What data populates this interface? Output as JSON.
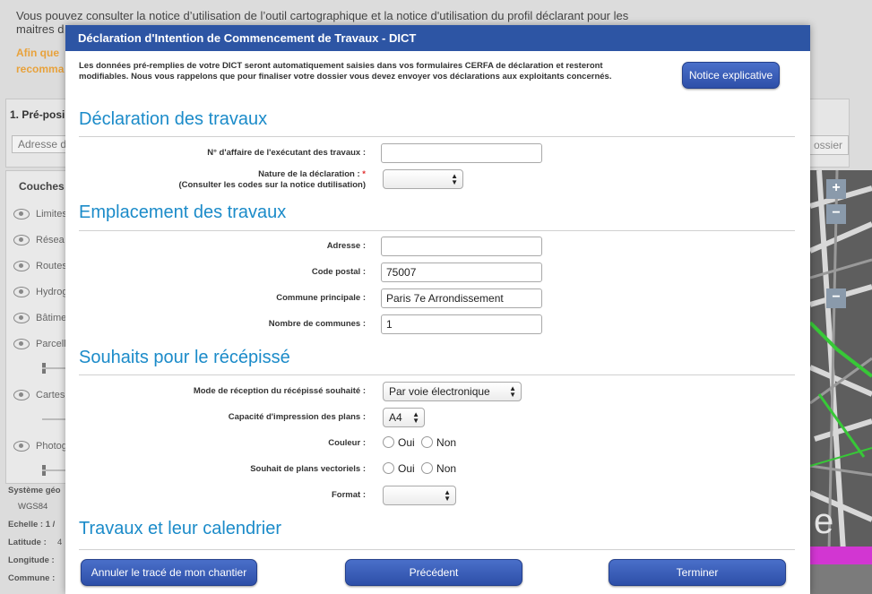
{
  "background": {
    "intro_text": "Vous pouvez consulter la notice d’utilisation de l’outil cartographique et la notice d'utilisation du profil déclarant pour les maitres d",
    "warning_line1": "Afin que",
    "warning_line2": "recomma",
    "panel_title": "1. Pré-posi",
    "address_placeholder": "Adresse d",
    "right_button": "ossier",
    "layers_title": "Couches",
    "layers": [
      "Limites",
      "Résea",
      "Routes",
      "Hydrog",
      "Bâtime",
      "Parcell",
      "Cartes",
      "Photog"
    ],
    "coords": {
      "system_label": "Système géo",
      "system_value": "WGS84",
      "scale_label": "Echelle : 1 /",
      "latitude_label": "Latitude :",
      "latitude_value": "4",
      "longitude_label": "Longitude :",
      "commune_label": "Commune :"
    },
    "zoom_in": "+",
    "zoom_out": "−",
    "zoom_minus": "−"
  },
  "modal": {
    "title": "Déclaration d'Intention de Commencement de Travaux - DICT",
    "notice_text": "Les données pré-remplies de votre DICT seront automatiquement saisies dans vos formulaires CERFA de déclaration et resteront modifiables. Nous vous rappelons que pour finaliser votre dossier vous devez envoyer vos déclarations aux exploitants concernés.",
    "notice_button": "Notice explicative",
    "sections": {
      "travaux": {
        "title": "Déclaration des travaux",
        "affaire_label": "N° d'affaire de l'exécutant des travaux :",
        "affaire_value": "",
        "nature_label": "Nature de la déclaration :",
        "nature_required": "*",
        "nature_hint": "(Consulter les codes sur la notice dutilisation)",
        "nature_value": ""
      },
      "emplacement": {
        "title": "Emplacement des travaux",
        "adresse_label": "Adresse :",
        "adresse_value": "",
        "code_postal_label": "Code postal :",
        "code_postal_value": "75007",
        "commune_label": "Commune principale :",
        "commune_value": "Paris 7e Arrondissement",
        "nb_communes_label": "Nombre de communes :",
        "nb_communes_value": "1"
      },
      "recepisse": {
        "title": "Souhaits pour le récépissé",
        "mode_label": "Mode de réception du récépissé souhaité :",
        "mode_value": "Par voie électronique",
        "capacite_label": "Capacité d'impression des plans :",
        "capacite_value": "A4",
        "couleur_label": "Couleur :",
        "vectoriels_label": "Souhait de plans vectoriels :",
        "oui": "Oui",
        "non": "Non",
        "format_label": "Format :",
        "format_value": ""
      },
      "calendrier": {
        "title": "Travaux et leur calendrier"
      }
    },
    "footer": {
      "cancel_button": "Annuler le tracé de mon chantier",
      "previous_button": "Précédent",
      "finish_button": "Terminer"
    }
  }
}
